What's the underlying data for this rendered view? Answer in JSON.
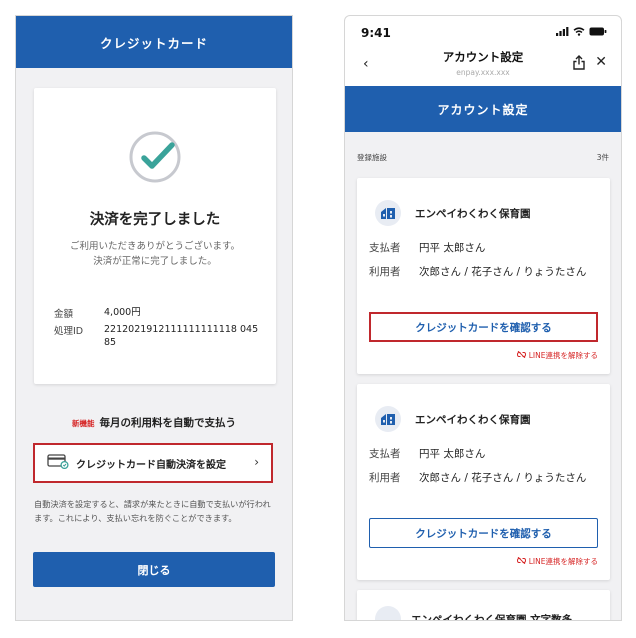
{
  "left": {
    "header_title": "クレジットカード",
    "done_title": "決済を完了しました",
    "done_msg_1": "ご利用いただきありがとうございます。",
    "done_msg_2": "決済が正常に完了しました。",
    "amount_label": "金額",
    "amount_value": "4,000円",
    "process_label": "処理ID",
    "process_value": "2212021912111111111118 04585",
    "promo_new": "新機能",
    "promo_text": "毎月の利用料を自動で支払う",
    "auto_button_label": "クレジットカード自動決済を設定",
    "auto_note": "自動決済を設定すると、請求が来たときに自動で支払いが行われます。これにより、支払い忘れを防ぐことができます。",
    "close_label": "閉じる"
  },
  "right": {
    "status_time": "9:41",
    "nav_title": "アカウント設定",
    "nav_url": "enpay.xxx.xxx",
    "header_title": "アカウント設定",
    "registered_label": "登録施設",
    "registered_count": "3件",
    "facilities": [
      {
        "name": "エンペイわくわく保育園",
        "payer_label": "支払者",
        "payer": "円平 太郎さん",
        "user_label": "利用者",
        "users": "次郎さん / 花子さん / りょうたさん",
        "confirm_label": "クレジットカードを確認する",
        "unlink_label": "LINE連携を解除する"
      },
      {
        "name": "エンペイわくわく保育園",
        "payer_label": "支払者",
        "payer": "円平 太郎さん",
        "user_label": "利用者",
        "users": "次郎さん / 花子さん / りょうたさん",
        "confirm_label": "クレジットカードを確認する",
        "unlink_label": "LINE連携を解除する"
      },
      {
        "name": "エンペイわくわく保育園 文字数多"
      }
    ]
  },
  "colors": {
    "brand_blue": "#1f5fae",
    "highlight_red": "#c0282d",
    "check_teal": "#3aa39a",
    "warning_red": "#d62424"
  },
  "icons": [
    "check-circle-icon",
    "credit-card-icon",
    "chevron-right-icon",
    "back-icon",
    "share-icon",
    "close-icon",
    "facility-icon",
    "unlink-icon",
    "signal-icon",
    "wifi-icon",
    "battery-icon"
  ]
}
